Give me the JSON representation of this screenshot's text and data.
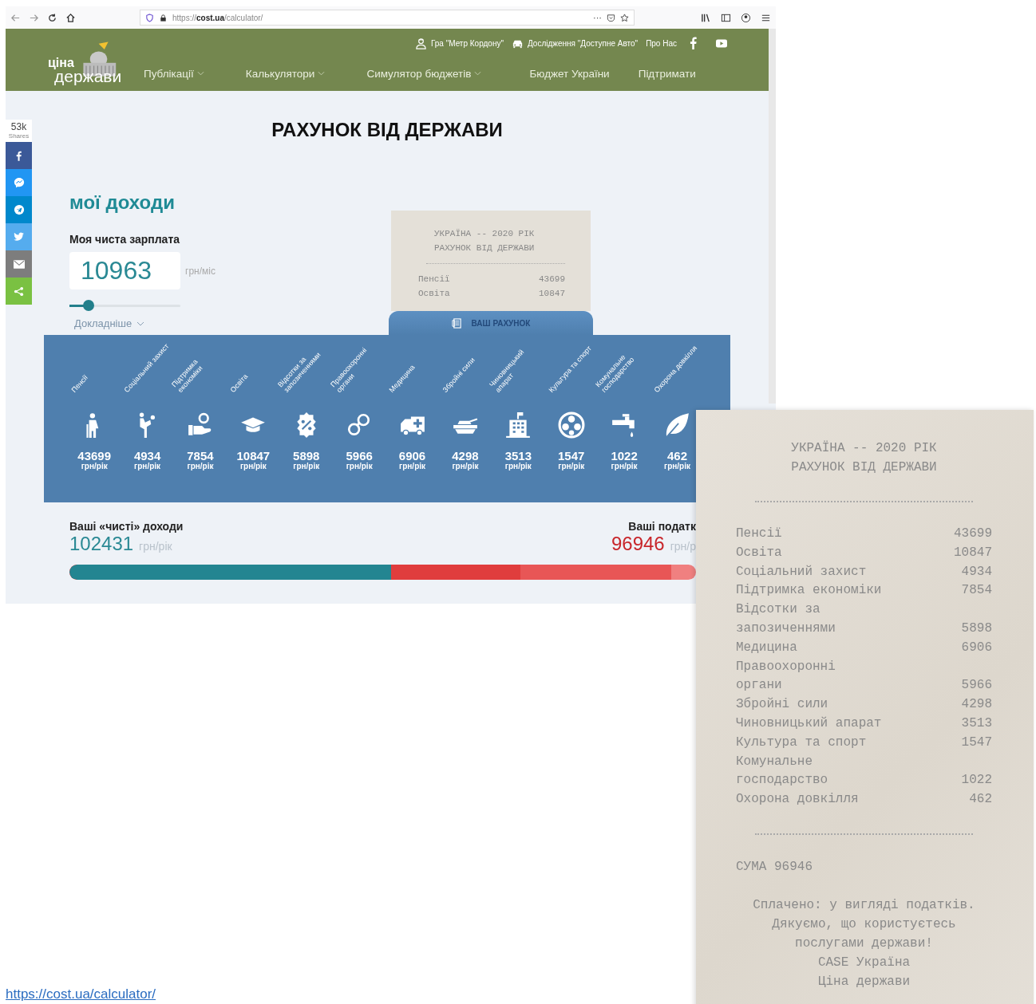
{
  "browser": {
    "url_prefix": "https://",
    "url_host": "cost.ua",
    "url_path": "/calculator/",
    "overflow_menu": "···"
  },
  "header": {
    "logo": [
      "ціна",
      "держави"
    ],
    "top_links": [
      {
        "label": "Гра \"Метр Кордону\"",
        "icon": true
      },
      {
        "label": "Дослідження \"Доступне Авто\"",
        "icon": true
      },
      {
        "label": "Про Нас",
        "icon": false
      }
    ],
    "nav": [
      {
        "label": "Публікації",
        "dropdown": true
      },
      {
        "label": "Калькулятори",
        "dropdown": true
      },
      {
        "label": "Симулятор бюджетів",
        "dropdown": true
      },
      {
        "label": "Бюджет України",
        "dropdown": false
      },
      {
        "label": "Підтримати",
        "dropdown": false
      }
    ]
  },
  "share": {
    "count": "53k",
    "caption": "Shares",
    "buttons": [
      {
        "kind": "facebook"
      },
      {
        "kind": "messenger"
      },
      {
        "kind": "telegram"
      },
      {
        "kind": "twitter"
      },
      {
        "kind": "email"
      },
      {
        "kind": "share"
      }
    ]
  },
  "title": "РАХУНОК ВІД ДЕРЖАВИ",
  "income": {
    "heading": "мої доходи",
    "label": "Моя чиста зарплата",
    "value": "10963",
    "unit": "грн/міс",
    "slider": {
      "level": 0.17
    },
    "more_link": "Докладніше"
  },
  "receipt_preview": {
    "lines": [
      "УКРАЇНА -- 2020 РІК",
      "РАХУНОК ВІД ДЕРЖАВИ"
    ],
    "items": [
      {
        "name": "Пенсії",
        "value": "43699"
      },
      {
        "name": "Освіта",
        "value": "10847"
      }
    ]
  },
  "receipt_tab": "ВАШ РАХУНОК",
  "categories": [
    {
      "label": "Пенсії",
      "value": "43699",
      "unit": "грн/рік"
    },
    {
      "label": "Соціальний захист",
      "value": "4934",
      "unit": "грн/рік"
    },
    {
      "label": "Підтримка економіки",
      "value": "7854",
      "unit": "грн/рік"
    },
    {
      "label": "Освіта",
      "value": "10847",
      "unit": "грн/рік"
    },
    {
      "label": "Відсотки за запозиченнями",
      "value": "5898",
      "unit": "грн/рік"
    },
    {
      "label": "Правоохоронні органи",
      "value": "5966",
      "unit": "грн/рік"
    },
    {
      "label": "Медицина",
      "value": "6906",
      "unit": "грн/рік"
    },
    {
      "label": "Збройні сили",
      "value": "4298",
      "unit": "грн/рік"
    },
    {
      "label": "Чиновницький апарат",
      "value": "3513",
      "unit": "грн/рік"
    },
    {
      "label": "Культура та спорт",
      "value": "1547",
      "unit": "грн/рік"
    },
    {
      "label": "Комунальне господарство",
      "value": "1022",
      "unit": "грн/рік"
    },
    {
      "label": "Охорона довкілля",
      "value": "462",
      "unit": "грн/рік"
    }
  ],
  "totals": {
    "income_label": "Ваші «чисті» доходи",
    "income_value": "102431",
    "income_unit": "грн/рік",
    "tax_label": "Ваші податк",
    "tax_value": "96946",
    "tax_unit": "грн/р",
    "bar": {
      "level": 0.514
    }
  },
  "receipt": {
    "header": [
      "УКРАЇНА -- 2020 РІК",
      "РАХУНОК ВІД ДЕРЖАВИ"
    ],
    "items": [
      {
        "name": "Пенсії",
        "value": "43699"
      },
      {
        "name": "Освіта",
        "value": "10847"
      },
      {
        "name": "Соціальний захист",
        "value": "4934"
      },
      {
        "name": "Підтримка економіки",
        "value": "7854"
      },
      {
        "name": "Відсотки за запозиченнями",
        "value": "5898"
      },
      {
        "name": "Медицина",
        "value": "6906"
      },
      {
        "name": "Правоохоронні органи",
        "value": "5966"
      },
      {
        "name": "Збройні сили",
        "value": "4298"
      },
      {
        "name": "Чиновницький апарат",
        "value": "3513"
      },
      {
        "name": "Культура та спорт",
        "value": "1547"
      },
      {
        "name": "Комунальне господарство",
        "value": "1022"
      },
      {
        "name": "Охорона довкілля",
        "value": "462"
      }
    ],
    "sum": "СУМА 96946",
    "footer": [
      "Сплачено: у вигляді податків.",
      "Дякуємо, що користуєтесь",
      "послугами держави!",
      "CASE Україна",
      "Ціна держави"
    ]
  },
  "source_link": "https://cost.ua/calculator/"
}
